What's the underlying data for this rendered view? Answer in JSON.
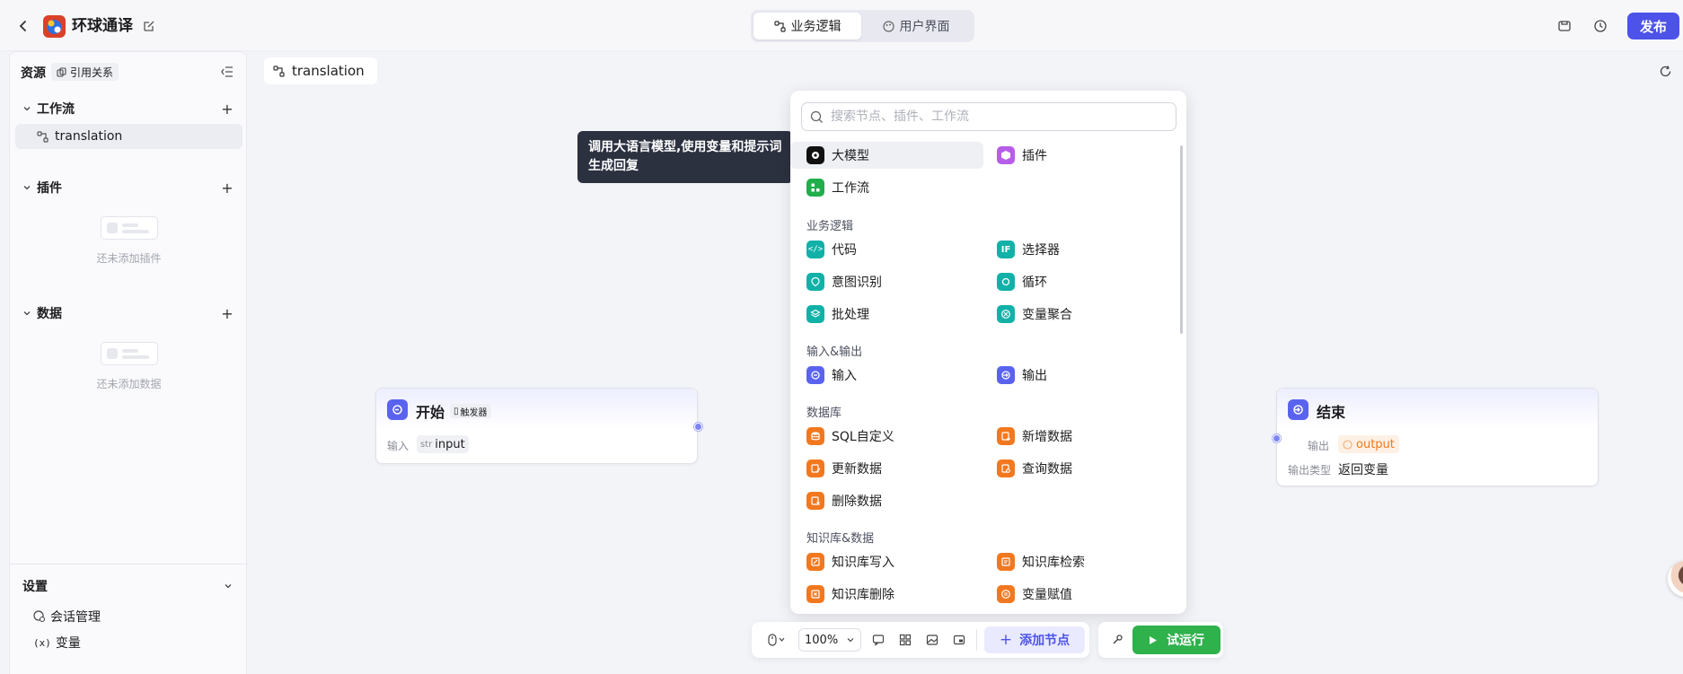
{
  "header": {
    "app_name": "环球通译",
    "tabs": [
      {
        "label": "业务逻辑",
        "active": true
      },
      {
        "label": "用户界面",
        "active": false
      }
    ],
    "publish_label": "发布"
  },
  "sidebar": {
    "resources_label": "资源",
    "ref_label": "引用关系",
    "workflow": {
      "label": "工作流",
      "items": [
        "translation"
      ]
    },
    "plugins": {
      "label": "插件",
      "empty_text": "还未添加插件"
    },
    "data": {
      "label": "数据",
      "empty_text": "还未添加数据"
    },
    "settings": {
      "label": "设置",
      "items": [
        {
          "label": "会话管理",
          "icon": "chat-settings-icon"
        },
        {
          "label": "变量",
          "icon": "variable-icon"
        }
      ]
    }
  },
  "canvas": {
    "tab_label": "translation",
    "start_node": {
      "title": "开始",
      "badge": "触发器",
      "input_label": "输入",
      "type_tag": "str",
      "param": "input"
    },
    "end_node": {
      "title": "结束",
      "output_label": "输出",
      "output_var": "output",
      "output_type_label": "输出类型",
      "output_type_value": "返回变量"
    }
  },
  "node_popup": {
    "search_placeholder": "搜索节点、插件、工作流",
    "top_items": [
      {
        "label": "大模型",
        "color": "#111111"
      },
      {
        "label": "插件",
        "color": "#b65ee8"
      },
      {
        "label": "工作流",
        "color": "#1fae4a"
      }
    ],
    "categories": [
      {
        "title": "业务逻辑",
        "items": [
          {
            "label": "代码",
            "color": "#12b1a8"
          },
          {
            "label": "选择器",
            "color": "#12b1a8"
          },
          {
            "label": "意图识别",
            "color": "#12b1a8"
          },
          {
            "label": "循环",
            "color": "#12b1a8"
          },
          {
            "label": "批处理",
            "color": "#12b1a8"
          },
          {
            "label": "变量聚合",
            "color": "#12b1a8"
          }
        ]
      },
      {
        "title": "输入&输出",
        "items": [
          {
            "label": "输入",
            "color": "#5a63f0"
          },
          {
            "label": "输出",
            "color": "#5a63f0"
          }
        ]
      },
      {
        "title": "数据库",
        "items": [
          {
            "label": "SQL自定义",
            "color": "#f2781f"
          },
          {
            "label": "新增数据",
            "color": "#f2781f"
          },
          {
            "label": "更新数据",
            "color": "#f2781f"
          },
          {
            "label": "查询数据",
            "color": "#f2781f"
          },
          {
            "label": "删除数据",
            "color": "#f2781f"
          }
        ]
      },
      {
        "title": "知识库&数据",
        "items": [
          {
            "label": "知识库写入",
            "color": "#f2781f"
          },
          {
            "label": "知识库检索",
            "color": "#f2781f"
          },
          {
            "label": "知识库删除",
            "color": "#f2781f"
          },
          {
            "label": "变量赋值",
            "color": "#f2781f"
          }
        ]
      }
    ]
  },
  "tooltip": {
    "text": "调用大语言模型,使用变量和提示词生成回复"
  },
  "toolbar": {
    "zoom": "100%",
    "add_node_label": "添加节点",
    "run_label": "试运行"
  },
  "colors": {
    "accent": "#4d53e8",
    "run": "#2fb14b",
    "node_icon": "#5a63f0"
  }
}
